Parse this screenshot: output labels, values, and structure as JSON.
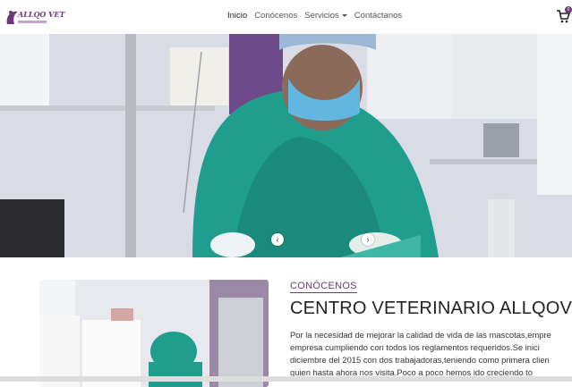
{
  "brand": {
    "name": "ALLQO VET"
  },
  "nav": {
    "items": [
      {
        "label": "Inicio",
        "active": true
      },
      {
        "label": "Conócenos",
        "active": false
      },
      {
        "label": "Servicios",
        "active": false,
        "dropdown": true
      },
      {
        "label": "Contáctanos",
        "active": false
      }
    ],
    "cart_count": "0"
  },
  "hero": {
    "prev_label": "‹",
    "next_label": "›"
  },
  "about": {
    "kicker": "CONÓCENOS",
    "title": "CENTRO VETERINARIO ALLQOVET",
    "lines": [
      "Por la necesidad de mejorar la calidad de vida de las mascotas,empre",
      "empresa cumpliendo con todos los reglamentos requeridos.Se inici",
      "diciembre del 2015 con dos trabajadoras,teniendo como primera clien",
      "quien hasta ahora nos visita.Poco a poco hemos ido creciendo to"
    ]
  },
  "colors": {
    "brand": "#6b3a75",
    "scrub": "#1f9e8e"
  }
}
